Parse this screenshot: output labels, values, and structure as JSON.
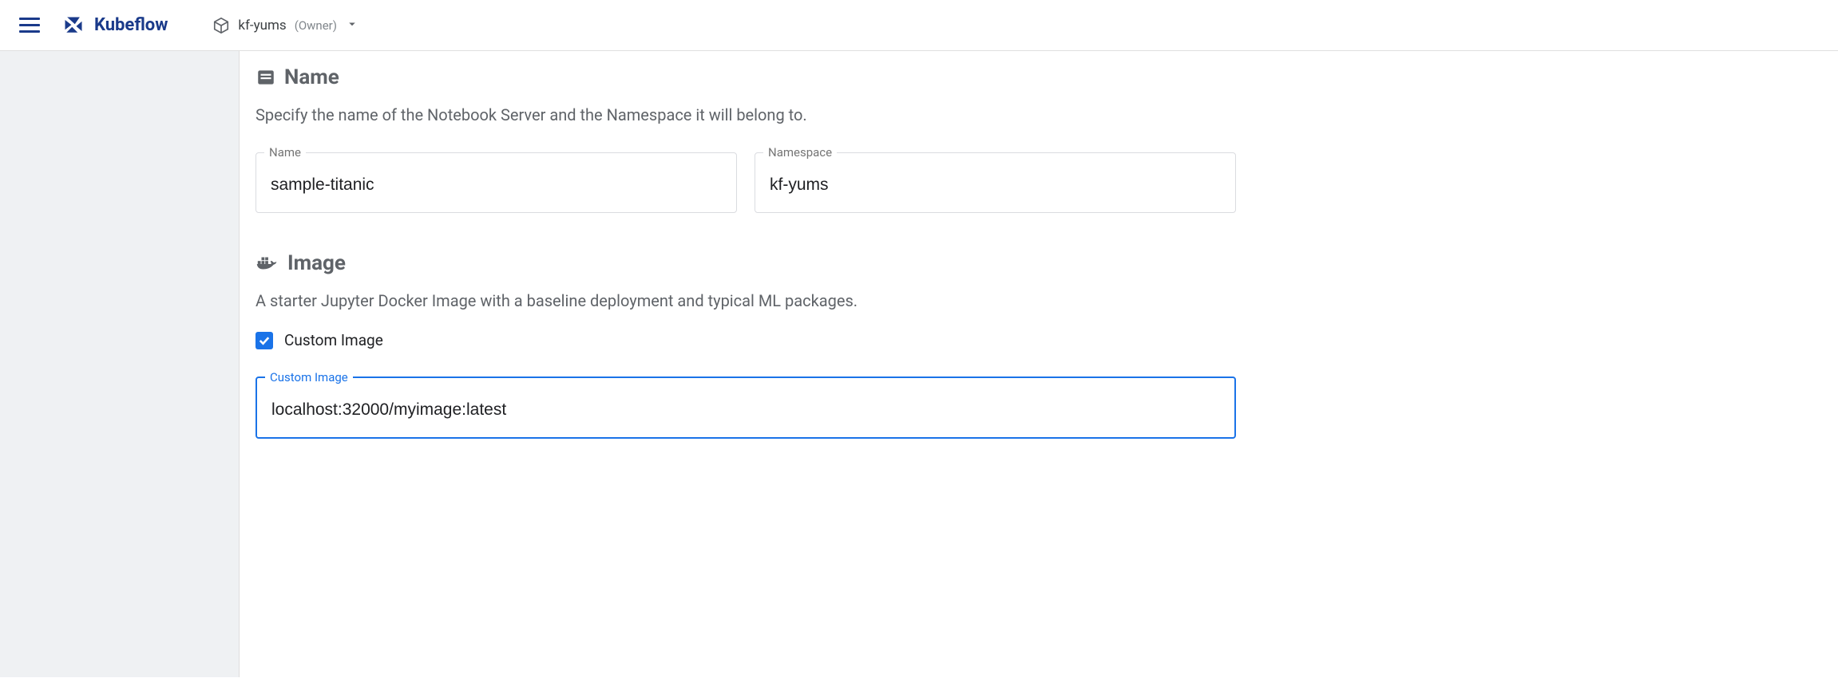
{
  "header": {
    "logo_text": "Kubeflow",
    "namespace": {
      "name": "kf-yums",
      "role": "(Owner)"
    }
  },
  "sections": {
    "name": {
      "title": "Name",
      "description": "Specify the name of the Notebook Server and the Namespace it will belong to.",
      "fields": {
        "name_label": "Name",
        "name_value": "sample-titanic",
        "namespace_label": "Namespace",
        "namespace_value": "kf-yums"
      }
    },
    "image": {
      "title": "Image",
      "description": "A starter Jupyter Docker Image with a baseline deployment and typical ML packages.",
      "custom_checkbox_label": "Custom Image",
      "custom_image_label": "Custom Image",
      "custom_image_value": "localhost:32000/myimage:latest"
    }
  }
}
